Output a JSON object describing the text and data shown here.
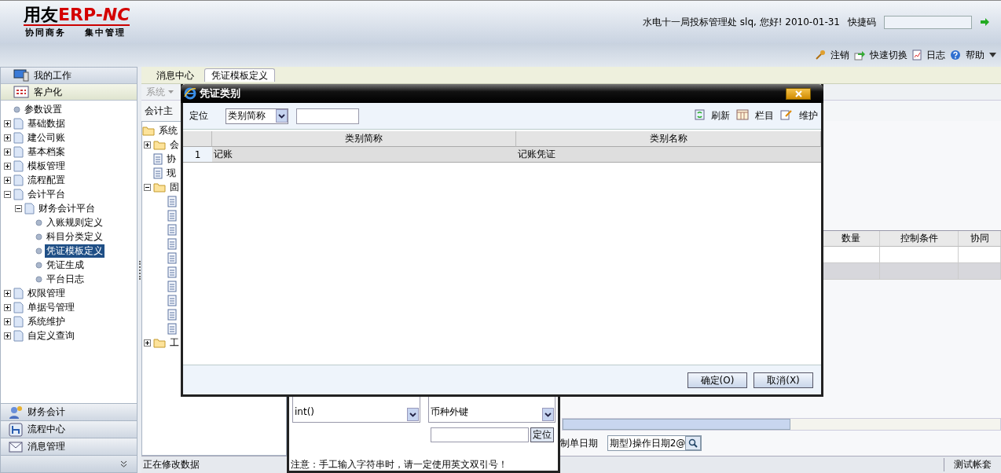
{
  "header": {
    "logo": {
      "brand": "用友",
      "mark": "ERP-",
      "suffix": "NC",
      "tagline": [
        "协同商务",
        "集中管理"
      ]
    },
    "greeting": "水电十一局投标管理处 slq, 您好! 2010-01-31",
    "shortcut": {
      "label": "快捷码"
    }
  },
  "quick_links": [
    {
      "kind": "logout",
      "label": "注销"
    },
    {
      "kind": "switch",
      "label": "快速切换"
    },
    {
      "kind": "log",
      "label": "日志"
    },
    {
      "kind": "help",
      "label": "帮助",
      "dropdown": true
    }
  ],
  "sidebar": {
    "sections": [
      {
        "kind": "work",
        "label": "我的工作",
        "selected": false
      },
      {
        "kind": "custom",
        "label": "客户化",
        "selected": true
      }
    ],
    "tree": [
      {
        "kind": "leaf",
        "label": "参数设置",
        "selected": false
      },
      {
        "kind": "node",
        "label": "基础数据",
        "expanded": false,
        "selected": false
      },
      {
        "kind": "node",
        "label": "建公司账",
        "expanded": false,
        "selected": false
      },
      {
        "kind": "node",
        "label": "基本档案",
        "expanded": false,
        "selected": false
      },
      {
        "kind": "node",
        "label": "模板管理",
        "expanded": false,
        "selected": false
      },
      {
        "kind": "node",
        "label": "流程配置",
        "expanded": false,
        "selected": false
      },
      {
        "kind": "node",
        "label": "会计平台",
        "expanded": true,
        "selected": false,
        "children": [
          {
            "kind": "node",
            "label": "财务会计平台",
            "expanded": true,
            "selected": false,
            "children": [
              {
                "kind": "leaf",
                "label": "入账规则定义",
                "selected": false
              },
              {
                "kind": "leaf",
                "label": "科目分类定义",
                "selected": false
              },
              {
                "kind": "leaf",
                "label": "凭证模板定义",
                "selected": true
              },
              {
                "kind": "leaf",
                "label": "凭证生成",
                "selected": false
              },
              {
                "kind": "leaf",
                "label": "平台日志",
                "selected": false
              }
            ]
          }
        ]
      },
      {
        "kind": "node",
        "label": "权限管理",
        "expanded": false,
        "selected": false
      },
      {
        "kind": "node",
        "label": "单据号管理",
        "expanded": false,
        "selected": false
      },
      {
        "kind": "node",
        "label": "系统维护",
        "expanded": false,
        "selected": false
      },
      {
        "kind": "node",
        "label": "自定义查询",
        "expanded": false,
        "selected": false
      }
    ],
    "bottom_sections": [
      {
        "kind": "finance",
        "label": "财务会计"
      },
      {
        "kind": "flow",
        "label": "流程中心"
      },
      {
        "kind": "message",
        "label": "消息管理"
      }
    ]
  },
  "tabs": [
    {
      "label": "消息中心",
      "selected": false
    },
    {
      "label": "凭证模板定义",
      "selected": true
    }
  ],
  "menu": {
    "label": "系统",
    "disabled": true
  },
  "entity_label": "会计主",
  "template_tree": [
    {
      "kind": "folder",
      "label": "系统",
      "children": [
        {
          "kind": "folder",
          "label": "会",
          "expanded": false
        },
        {
          "kind": "doc",
          "label": "协"
        },
        {
          "kind": "doc",
          "label": "现"
        },
        {
          "kind": "folder",
          "label": "固",
          "expanded": true,
          "children": [
            {
              "kind": "doc"
            },
            {
              "kind": "doc"
            },
            {
              "kind": "doc"
            },
            {
              "kind": "doc"
            },
            {
              "kind": "doc"
            },
            {
              "kind": "doc"
            },
            {
              "kind": "doc"
            },
            {
              "kind": "doc"
            },
            {
              "kind": "doc"
            },
            {
              "kind": "doc"
            }
          ]
        },
        {
          "kind": "folder",
          "label": "工",
          "expanded": false
        }
      ]
    }
  ],
  "grid": {
    "columns": [
      "数量",
      "控制条件",
      "协同"
    ],
    "rows": [
      {
        "selected": false
      },
      {
        "selected": true
      }
    ]
  },
  "date_field": {
    "label": "制单日期",
    "value": "期型)操作日期2@"
  },
  "status_bar": {
    "message": "正在修改数据",
    "account": "测试帐套"
  },
  "formula_dialog": {
    "functions": [
      "int()"
    ],
    "fields": [
      "币种外键"
    ],
    "search_button": "定位",
    "note": "注意：手工输入字符串时，请一定使用英文双引号！"
  },
  "dialog": {
    "title": "凭证类别",
    "locate_label": "定位",
    "locate_by": "类别简称",
    "actions": [
      {
        "kind": "refresh",
        "label": "刷新"
      },
      {
        "kind": "columns",
        "label": "栏目"
      },
      {
        "kind": "edit",
        "label": "维护"
      }
    ],
    "columns": [
      "类别简称",
      "类别名称"
    ],
    "rows": [
      {
        "index": "1",
        "cells": [
          "记账",
          "记账凭证"
        ],
        "selected": true
      }
    ],
    "buttons": [
      "确定(O)",
      "取消(X)"
    ]
  }
}
